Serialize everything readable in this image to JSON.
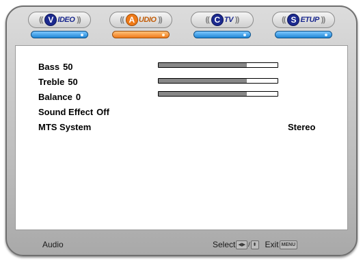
{
  "tabs": [
    {
      "letter": "V",
      "rest": "IDEO",
      "active": false
    },
    {
      "letter": "A",
      "rest": "UDIO",
      "active": true
    },
    {
      "letter": "C",
      "rest": "TV",
      "active": false
    },
    {
      "letter": "S",
      "rest": "ETUP",
      "active": false
    }
  ],
  "menu": {
    "bass": {
      "label": "Bass",
      "value": "50",
      "level": 0.74
    },
    "treble": {
      "label": "Treble",
      "value": "50",
      "level": 0.74
    },
    "balance": {
      "label": "Balance",
      "value": "0",
      "level": 0.74
    },
    "sound_effect": {
      "label": "Sound Effect",
      "value": "Off"
    },
    "mts": {
      "label": "MTS System",
      "value": "Stereo"
    }
  },
  "footer": {
    "title": "Audio",
    "select_label": "Select",
    "select_key_lr": "◀▶",
    "select_key_sep": "/",
    "select_key_ud": "⬍",
    "exit_label": "Exit",
    "exit_key": "MENU"
  },
  "colors": {
    "tab_blue": "#1c2a8f",
    "tab_active_orange": "#ef7a18",
    "bar_blue": "#1f86d6",
    "slider_fill": "#888888"
  }
}
